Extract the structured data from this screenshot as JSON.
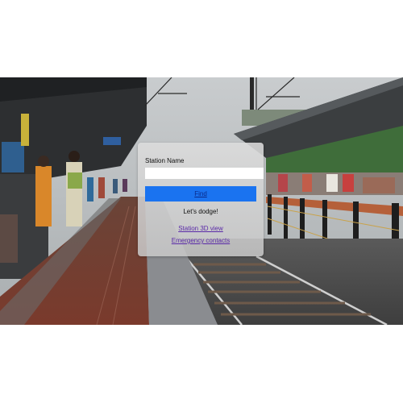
{
  "form": {
    "station_label": "Station Name",
    "station_value": "",
    "station_placeholder": "",
    "find_label": "Find",
    "tagline": "Let's dodge!"
  },
  "links": {
    "station_3d_view": "Station 3D view",
    "emergency_contacts": "Emergency contacts"
  },
  "colors": {
    "find_button_bg": "#1a73f0",
    "link_color": "#5a2aa8",
    "page_background": "#ffffff"
  },
  "background_image": {
    "subject": "railway-station-platform-photo"
  }
}
